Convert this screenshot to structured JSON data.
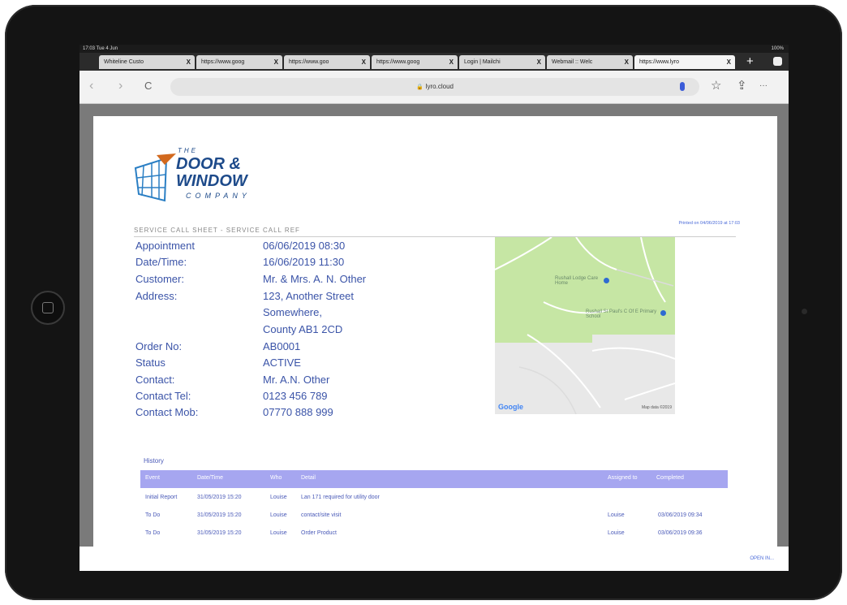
{
  "status": {
    "time": "17:03 Tue 4 Jun",
    "right": "100%"
  },
  "tabs": [
    {
      "label": "Whiteline Custo"
    },
    {
      "label": "https://www.goog"
    },
    {
      "label": "https://www.goo"
    },
    {
      "label": "https://www.goog"
    },
    {
      "label": "Login | Mailchi"
    },
    {
      "label": "Webmail :: Welc"
    },
    {
      "label": "https://www.lyro"
    }
  ],
  "browser": {
    "url": "lyro.cloud",
    "plus": "+",
    "back": "‹",
    "forward": "›",
    "reload": "C",
    "star": "☆",
    "share": "⇪",
    "more": "···",
    "lock": "🔒"
  },
  "logo": {
    "the": "THE",
    "line1": "DOOR &",
    "line2": "WINDOW",
    "line3": "COMPANY"
  },
  "sheet": {
    "title": "SERVICE CALL SHEET - SERVICE CALL REF",
    "printed": "Printed on 04/06/2019 at 17:03"
  },
  "details": [
    {
      "label": "Appointment",
      "value": "06/06/2019 08:30"
    },
    {
      "label": "Date/Time:",
      "value": "16/06/2019 11:30"
    },
    {
      "label": "Customer:",
      "value": "Mr. & Mrs. A. N. Other"
    },
    {
      "label": "Address:",
      "value": "123, Another Street"
    },
    {
      "label": "",
      "value": "Somewhere,"
    },
    {
      "label": "",
      "value": "County AB1 2CD"
    },
    {
      "label": "Order No:",
      "value": "AB0001"
    },
    {
      "label": "Status",
      "value": "ACTIVE"
    },
    {
      "label": "Contact:",
      "value": "Mr. A.N. Other"
    },
    {
      "label": "Contact Tel:",
      "value": "0123 456 789"
    },
    {
      "label": "Contact Mob:",
      "value": "07770 888 999"
    }
  ],
  "map": {
    "poi1": "Rushall Lodge Care Home",
    "poi2": "Rushall St Paul's C Of E Primary School",
    "google": "Google",
    "mapdata": "Map data ©2019"
  },
  "history": {
    "label": "History",
    "columns": [
      "Event",
      "Date/Time",
      "Who",
      "Detail",
      "Assigned to",
      "Completed"
    ],
    "rows": [
      {
        "event": "Initial Report",
        "datetime": "31/05/2019 15:20",
        "who": "Louise",
        "detail": "Lan 171 required for utility door",
        "assigned": "",
        "completed": ""
      },
      {
        "event": "To Do",
        "datetime": "31/05/2019 15:20",
        "who": "Louise",
        "detail": "contact/site visit",
        "assigned": "Louise",
        "completed": "03/06/2019 09:34"
      },
      {
        "event": "To Do",
        "datetime": "31/05/2019 15:20",
        "who": "Louise",
        "detail": "Order Product",
        "assigned": "Louise",
        "completed": "03/06/2019 09:36"
      }
    ]
  },
  "footer": {
    "open_in": "OPEN IN..."
  }
}
